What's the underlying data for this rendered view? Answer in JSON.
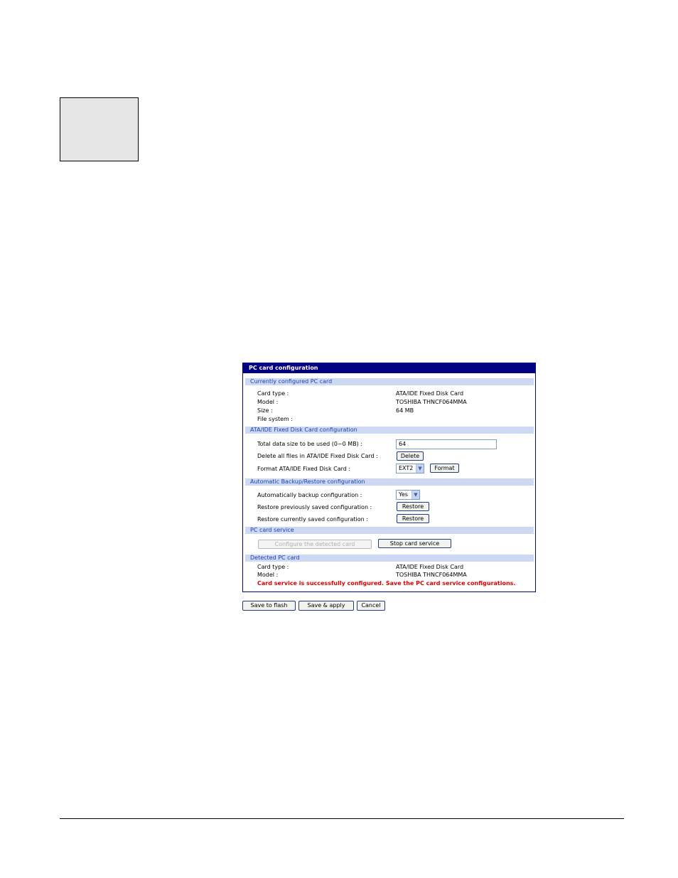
{
  "panel": {
    "title": "PC card configuration",
    "current": {
      "header": "Currently configured PC card",
      "card_type_label": "Card type :",
      "card_type_value": "ATA/IDE Fixed Disk Card",
      "model_label": "Model :",
      "model_value": "TOSHIBA THNCF064MMA",
      "size_label": "Size :",
      "size_value": "64 MB",
      "fs_label": "File system :"
    },
    "ata": {
      "header": "ATA/IDE Fixed Disk Card configuration",
      "total_label": "Total data size to be used (0~0 MB) :",
      "total_value": "64",
      "delete_label": "Delete all files in ATA/IDE Fixed Disk Card :",
      "delete_button": "Delete",
      "format_label": "Format ATA/IDE Fixed Disk Card :",
      "format_select": "EXT2",
      "format_button": "Format"
    },
    "backup": {
      "header": "Automatic Backup/Restore configuration",
      "auto_label": "Automatically backup configuration :",
      "auto_select": "Yes",
      "restore_prev_label": "Restore previously saved configuration :",
      "restore_prev_button": "Restore",
      "restore_curr_label": "Restore currently saved configuration :",
      "restore_curr_button": "Restore"
    },
    "service": {
      "header": "PC card service",
      "configure_button": "Configure the detected card",
      "stop_button": "Stop card service"
    },
    "detected": {
      "header": "Detected PC card",
      "card_type_label": "Card type :",
      "card_type_value": "ATA/IDE Fixed Disk Card",
      "model_label": "Model :",
      "model_value": "TOSHIBA THNCF064MMA",
      "message": "Card service is successfully configured. Save the PC card service configurations."
    }
  },
  "actions": {
    "save_flash": "Save to flash",
    "save_apply": "Save & apply",
    "cancel": "Cancel"
  },
  "colors": {
    "title_bar": "#000080",
    "section_bg": "#cdd9f3",
    "section_text": "#1c3fae",
    "message": "#e00000"
  },
  "icons": {
    "dropdown": "chevron-down-icon"
  }
}
